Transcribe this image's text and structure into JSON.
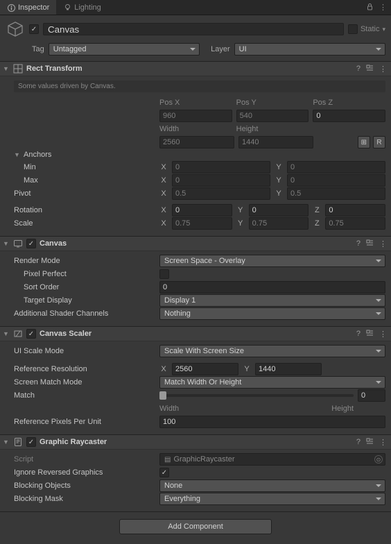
{
  "tabs": {
    "inspector": "Inspector",
    "lighting": "Lighting"
  },
  "go": {
    "active": true,
    "name": "Canvas",
    "static_label": "Static",
    "static": false,
    "tag_label": "Tag",
    "tag_value": "Untagged",
    "layer_label": "Layer",
    "layer_value": "UI"
  },
  "rect": {
    "title": "Rect Transform",
    "driven_note": "Some values driven by Canvas.",
    "cols": {
      "posx": "Pos X",
      "posy": "Pos Y",
      "posz": "Pos Z",
      "width": "Width",
      "height": "Height"
    },
    "pos": {
      "x": "960",
      "y": "540",
      "z": "0"
    },
    "size": {
      "w": "2560",
      "h": "1440"
    },
    "btn_blueprint": "⊞",
    "btn_raw": "R",
    "anchors_label": "Anchors",
    "min_label": "Min",
    "min": {
      "x": "0",
      "y": "0"
    },
    "max_label": "Max",
    "max": {
      "x": "0",
      "y": "0"
    },
    "pivot_label": "Pivot",
    "pivot": {
      "x": "0.5",
      "y": "0.5"
    },
    "rotation_label": "Rotation",
    "rotation": {
      "x": "0",
      "y": "0",
      "z": "0"
    },
    "scale_label": "Scale",
    "scale": {
      "x": "0.75",
      "y": "0.75",
      "z": "0.75"
    },
    "axis": {
      "x": "X",
      "y": "Y",
      "z": "Z"
    }
  },
  "canvas": {
    "title": "Canvas",
    "enabled": true,
    "render_mode_label": "Render Mode",
    "render_mode": "Screen Space - Overlay",
    "pixel_perfect_label": "Pixel Perfect",
    "pixel_perfect": false,
    "sort_order_label": "Sort Order",
    "sort_order": "0",
    "target_display_label": "Target Display",
    "target_display": "Display 1",
    "shader_channels_label": "Additional Shader Channels",
    "shader_channels": "Nothing"
  },
  "scaler": {
    "title": "Canvas Scaler",
    "enabled": true,
    "scale_mode_label": "UI Scale Mode",
    "scale_mode": "Scale With Screen Size",
    "ref_res_label": "Reference Resolution",
    "ref_res": {
      "x": "2560",
      "y": "1440"
    },
    "match_mode_label": "Screen Match Mode",
    "match_mode": "Match Width Or Height",
    "match_label": "Match",
    "match_value": "0",
    "match_left": "Width",
    "match_right": "Height",
    "ref_ppu_label": "Reference Pixels Per Unit",
    "ref_ppu": "100",
    "axis": {
      "x": "X",
      "y": "Y"
    }
  },
  "raycaster": {
    "title": "Graphic Raycaster",
    "enabled": true,
    "script_label": "Script",
    "script_value": "GraphicRaycaster",
    "ignore_reversed_label": "Ignore Reversed Graphics",
    "ignore_reversed": true,
    "blocking_objects_label": "Blocking Objects",
    "blocking_objects": "None",
    "blocking_mask_label": "Blocking Mask",
    "blocking_mask": "Everything"
  },
  "add_component": "Add Component"
}
